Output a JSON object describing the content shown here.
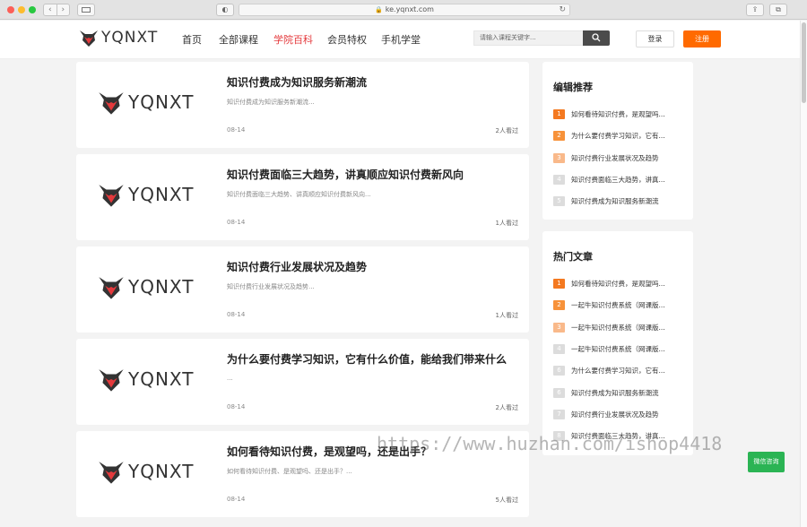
{
  "browser": {
    "url": "ke.yqnxt.com"
  },
  "header": {
    "logo_text": "YQNXT",
    "nav": [
      {
        "label": "首页",
        "active": false
      },
      {
        "label": "全部课程",
        "active": false
      },
      {
        "label": "学院百科",
        "active": true
      },
      {
        "label": "会员特权",
        "active": false
      },
      {
        "label": "手机学堂",
        "active": false
      }
    ],
    "search_placeholder": "请输入课程关键字...",
    "login_label": "登录",
    "register_label": "注册"
  },
  "articles": [
    {
      "thumb_text": "YQNXT",
      "title": "知识付费成为知识服务新潮流",
      "summary": "知识付费成为知识服务新潮流...",
      "date": "08-14",
      "views": "2人看过"
    },
    {
      "thumb_text": "YQNXT",
      "title": "知识付费面临三大趋势，讲真顺应知识付费新风向",
      "summary": "知识付费面临三大趋势、讲真顺应知识付费新风向...",
      "date": "08-14",
      "views": "1人看过"
    },
    {
      "thumb_text": "YQNXT",
      "title": "知识付费行业发展状况及趋势",
      "summary": "知识付费行业发展状况及趋势...",
      "date": "08-14",
      "views": "1人看过"
    },
    {
      "thumb_text": "YQNXT",
      "title": "为什么要付费学习知识，它有什么价值，能给我们带来什么",
      "summary": "...",
      "date": "08-14",
      "views": "2人看过"
    },
    {
      "thumb_text": "YQNXT",
      "title": "如何看待知识付费，是观望吗，还是出手？",
      "summary": "如何看待知识付费、是观望吗、还是出手？...",
      "date": "08-14",
      "views": "5人看过"
    }
  ],
  "editor_picks": {
    "title": "编辑推荐",
    "items": [
      {
        "rank": "1",
        "text": "如何看待知识付费，是观望吗...",
        "color": "#f47920"
      },
      {
        "rank": "2",
        "text": "为什么要付费学习知识，它有...",
        "color": "#f7923a"
      },
      {
        "rank": "3",
        "text": "知识付费行业发展状况及趋势",
        "color": "#f9b98a"
      },
      {
        "rank": "4",
        "text": "知识付费面临三大趋势，讲真...",
        "color": "#dcdcdc"
      },
      {
        "rank": "5",
        "text": "知识付费成为知识服务新潮流",
        "color": "#dcdcdc"
      }
    ]
  },
  "hot_articles": {
    "title": "热门文章",
    "items": [
      {
        "rank": "1",
        "text": "如何看待知识付费，是观望吗...",
        "color": "#f47920"
      },
      {
        "rank": "2",
        "text": "一起牛知识付费系统（网课版...",
        "color": "#f7923a"
      },
      {
        "rank": "3",
        "text": "一起牛知识付费系统（网课版...",
        "color": "#f9b98a"
      },
      {
        "rank": "4",
        "text": "一起牛知识付费系统（网课版...",
        "color": "#dcdcdc"
      },
      {
        "rank": "6",
        "text": "为什么要付费学习知识，它有...",
        "color": "#dcdcdc"
      },
      {
        "rank": "6",
        "text": "知识付费成为知识服务新潮流",
        "color": "#dcdcdc"
      },
      {
        "rank": "7",
        "text": "知识付费行业发展状况及趋势",
        "color": "#dcdcdc"
      },
      {
        "rank": "8",
        "text": "知识付费面临三大趋势，讲真...",
        "color": "#dcdcdc"
      }
    ]
  },
  "floating": {
    "wechat_label": "微信咨询"
  },
  "watermark": "https://www.huzhan.com/ishop4418"
}
